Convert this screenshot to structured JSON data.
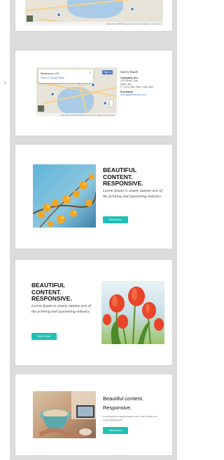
{
  "panel": {
    "arrow": "›"
  },
  "map_block": {
    "popup_title": "Melbourne VIC",
    "popup_link": "View on Google Maps",
    "popup_close": "×",
    "map_type": "Sign in",
    "footer": "Map data ©2015 Google  Terms of Use  Report a map error",
    "contact": {
      "heading": "Get in Touch",
      "company": "Company, Inc.",
      "address1": "123 Street, City",
      "address2": "State, Zip",
      "phone": "P: (123) 456-7890 / 456-7891",
      "name": "Full Name",
      "email": "first.last@example.com"
    }
  },
  "blocks": [
    {
      "headline_l1": "BEAUTIFUL",
      "headline_l2": "CONTENT.",
      "headline_l3": "RESPONSIVE.",
      "body": "Lorem Ipsum is simply dummy text of the printing and typesetting industry.",
      "button": "Read More"
    },
    {
      "headline_l1": "BEAUTIFUL",
      "headline_l2": "CONTENT.",
      "headline_l3": "RESPONSIVE.",
      "body": "Lorem Ipsum is simply dummy text of the printing and typesetting industry.",
      "button": "Read More"
    },
    {
      "headline_l1": "Beautiful content.",
      "headline_l2": "Responsive.",
      "body": "Lorem Ipsum is simply dummy text of the printing and typesetting industry.",
      "button": "Read More"
    }
  ],
  "colors": {
    "accent": "#21c0b5",
    "canvas": "#dcdcdc",
    "card": "#ffffff"
  }
}
